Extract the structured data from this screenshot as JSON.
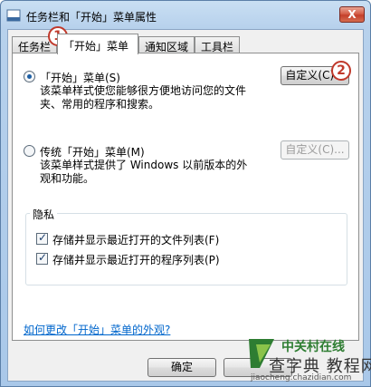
{
  "window": {
    "title": "任务栏和「开始」菜单属性",
    "close_glyph": "X"
  },
  "tabs": [
    {
      "label": "任务栏"
    },
    {
      "label": "「开始」菜单"
    },
    {
      "label": "通知区域"
    },
    {
      "label": "工具栏"
    }
  ],
  "start_menu_option": {
    "title": "「开始」菜单(S)",
    "description": "该菜单样式使您能够很方便地访问您的文件夹、常用的程序和搜索。",
    "customize_label": "自定义(C)..."
  },
  "classic_menu_option": {
    "title": "传统「开始」菜单(M)",
    "description": "该菜单样式提供了 Windows 以前版本的外观和功能。",
    "customize_label": "自定义(C)..."
  },
  "privacy": {
    "label": "隐私",
    "recent_files": "存储并显示最近打开的文件列表(F)",
    "recent_programs": "存储并显示最近打开的程序列表(P)"
  },
  "help_link": "如何更改「开始」菜单的外观?",
  "buttons": {
    "ok": "确定"
  },
  "annotations": [
    "1",
    "2"
  ],
  "watermark": {
    "brand": "中关村在线",
    "site": "查字典 教程网",
    "url": "jiaocheng.chazidian.com"
  },
  "colors": {
    "accent": "#1d5fa5",
    "annotation": "#c0392b",
    "link": "#0066cc"
  }
}
